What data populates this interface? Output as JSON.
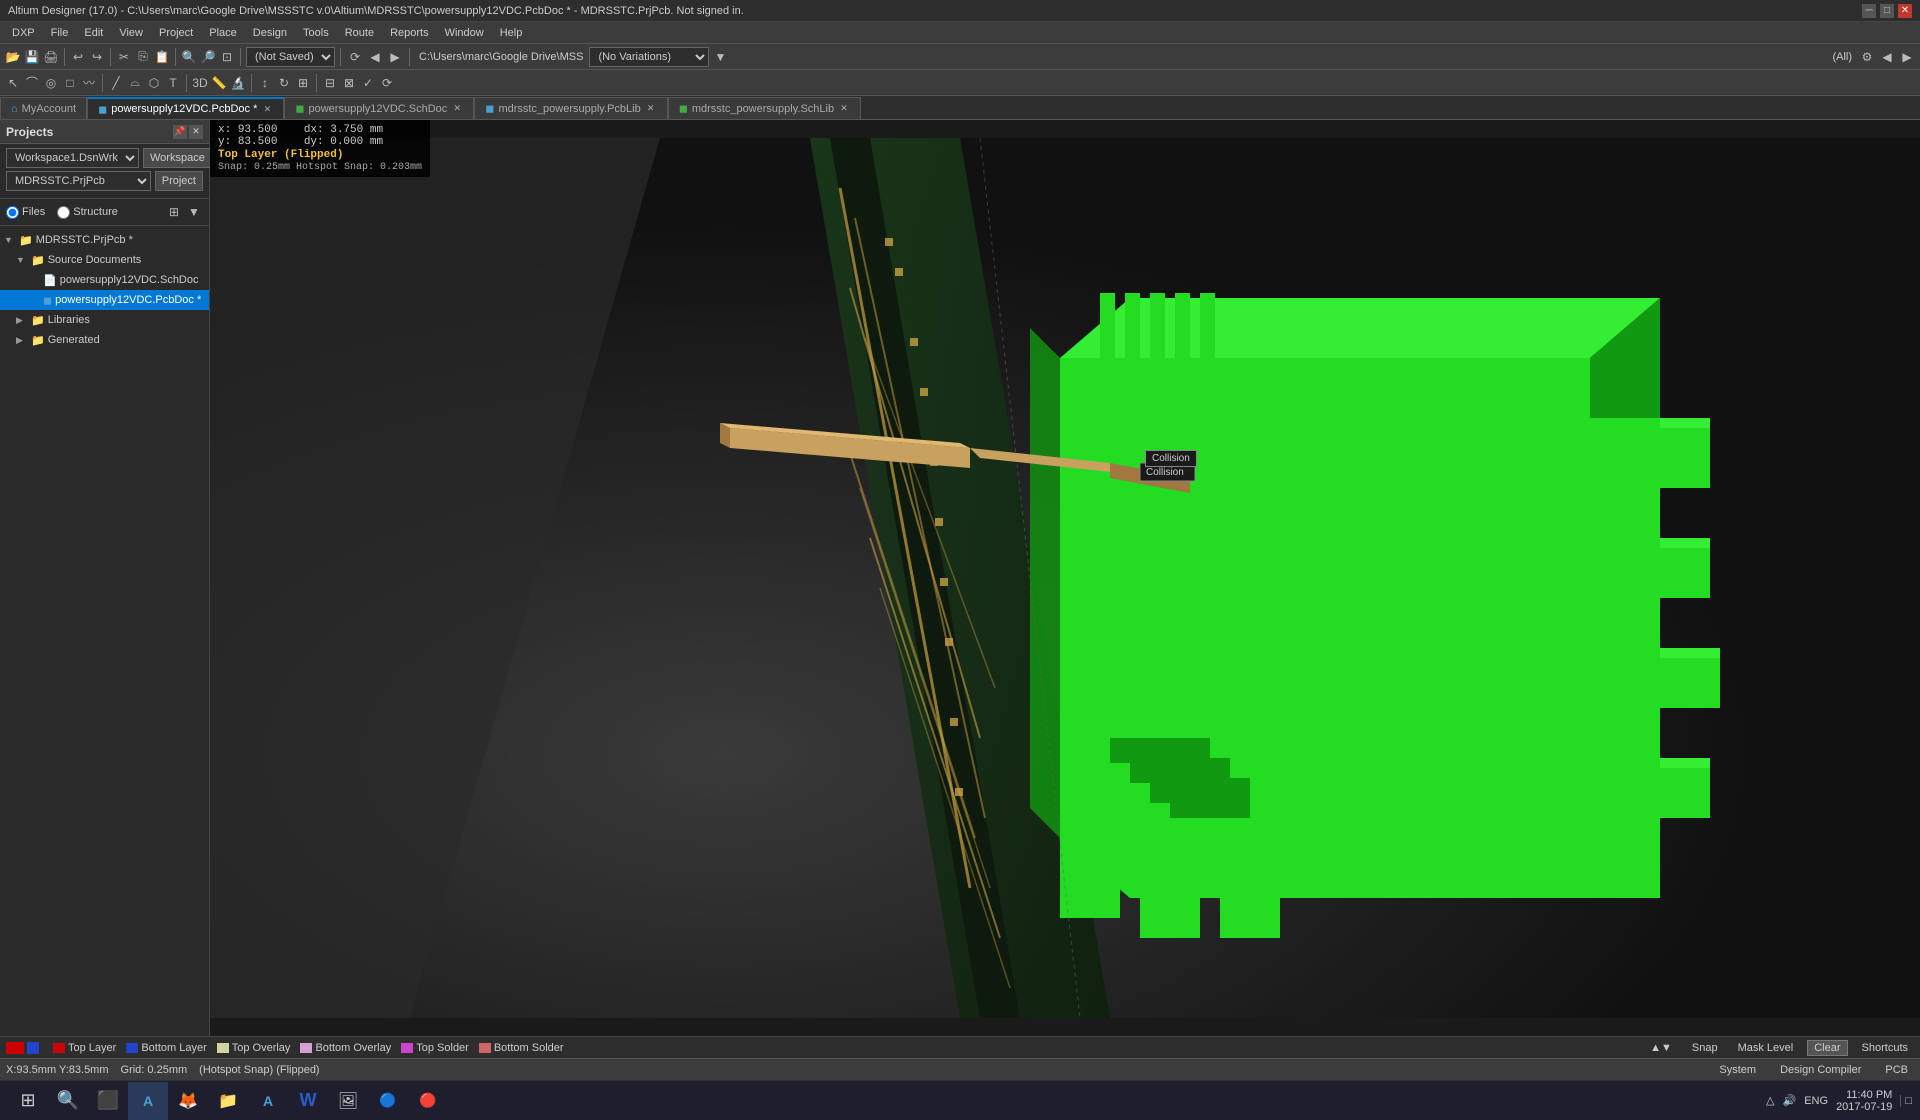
{
  "titlebar": {
    "text": "Altium Designer (17.0) - C:\\Users\\marc\\Google Drive\\MSSSTC v.0\\Altium\\MDRSSTC\\powersupply12VDC.PcbDoc * - MDRSSTC.PrjPcb. Not signed in.",
    "minimize": "─",
    "maximize": "□",
    "close": "✕"
  },
  "menubar": {
    "items": [
      "DXP",
      "File",
      "Edit",
      "View",
      "Project",
      "Place",
      "Design",
      "Tools",
      "Route",
      "Reports",
      "Window",
      "Help"
    ]
  },
  "toolbar": {
    "save_state": "(Not Saved)",
    "variations": "(No Variations)"
  },
  "path_display": {
    "left": "C:\\Users\\marc\\Google Drive\\MSS",
    "right": "(All)"
  },
  "tabs": [
    {
      "label": "MyAccount",
      "icon": "home",
      "active": false,
      "closable": false
    },
    {
      "label": "powersupply12VDC.PcbDoc *",
      "icon": "pcb",
      "active": true,
      "closable": true
    },
    {
      "label": "powersupply12VDC.SchDoc",
      "icon": "sch",
      "active": false,
      "closable": true
    },
    {
      "label": "mdrsstc_powersupply.PcbLib",
      "icon": "lib",
      "active": false,
      "closable": true
    },
    {
      "label": "mdrsstc_powersupply.SchLib",
      "icon": "schlib",
      "active": false,
      "closable": true
    }
  ],
  "panel": {
    "title": "Projects",
    "workspace_label": "Workspace",
    "workspace_name": "Workspace1.DsnWrk",
    "project_label": "Project",
    "project_name": "MDRSSTC.PrjPcb",
    "radio_files": "Files",
    "radio_structure": "Structure",
    "tree": {
      "project_root": "MDRSSTC.PrjPcb *",
      "source_documents": "Source Documents",
      "files": [
        {
          "name": "powersupply12VDC.SchDoc",
          "type": "sch",
          "indent": 3
        },
        {
          "name": "powersupply12VDC.PcbDoc *",
          "type": "pcb",
          "indent": 3,
          "selected": true
        }
      ],
      "libraries": "Libraries",
      "generated": "Generated"
    }
  },
  "coord_box": {
    "x_label": "x:",
    "x_value": "93.500",
    "dx_label": "dx:",
    "dx_value": "3.750 mm",
    "y_label": "y:",
    "y_value": "83.500",
    "dy_label": "dy:",
    "dy_value": "0.000 mm",
    "layer": "Top Layer (Flipped)",
    "snap": "Snap: 0.25mm Hotspot Snap: 0.203mm"
  },
  "collision_label": "Collision",
  "layers": [
    {
      "name": "Top Layer",
      "color": "#cc0000"
    },
    {
      "name": "Bottom Layer",
      "color": "#2244cc"
    },
    {
      "name": "Top Overlay",
      "color": "#d4d4a0"
    },
    {
      "name": "Bottom Overlay",
      "color": "#d4a0d4"
    },
    {
      "name": "Top Solder",
      "color": "#cc44cc"
    },
    {
      "name": "Bottom Solder",
      "color": "#cc6666"
    }
  ],
  "statusbar": {
    "position": "X:93.5mm Y:83.5mm",
    "grid": "Grid: 0.25mm",
    "snap_mode": "(Hotspot Snap) (Flipped)"
  },
  "right_status": {
    "system": "System",
    "design_compiler": "Design Compiler",
    "pcb": "PCB",
    "snap": "Snap",
    "mask_level": "Mask Level",
    "clear": "Clear",
    "shortcuts": "Shortcuts"
  },
  "taskbar": {
    "time": "11:40 PM",
    "date": "2017-07-19",
    "language": "ENG"
  },
  "icons": {
    "windows": "⊞",
    "search": "🔍",
    "edge": "◎",
    "altium": "A",
    "folder": "📁",
    "files": "📄",
    "word": "W",
    "photos": "🖼",
    "more": "●"
  }
}
